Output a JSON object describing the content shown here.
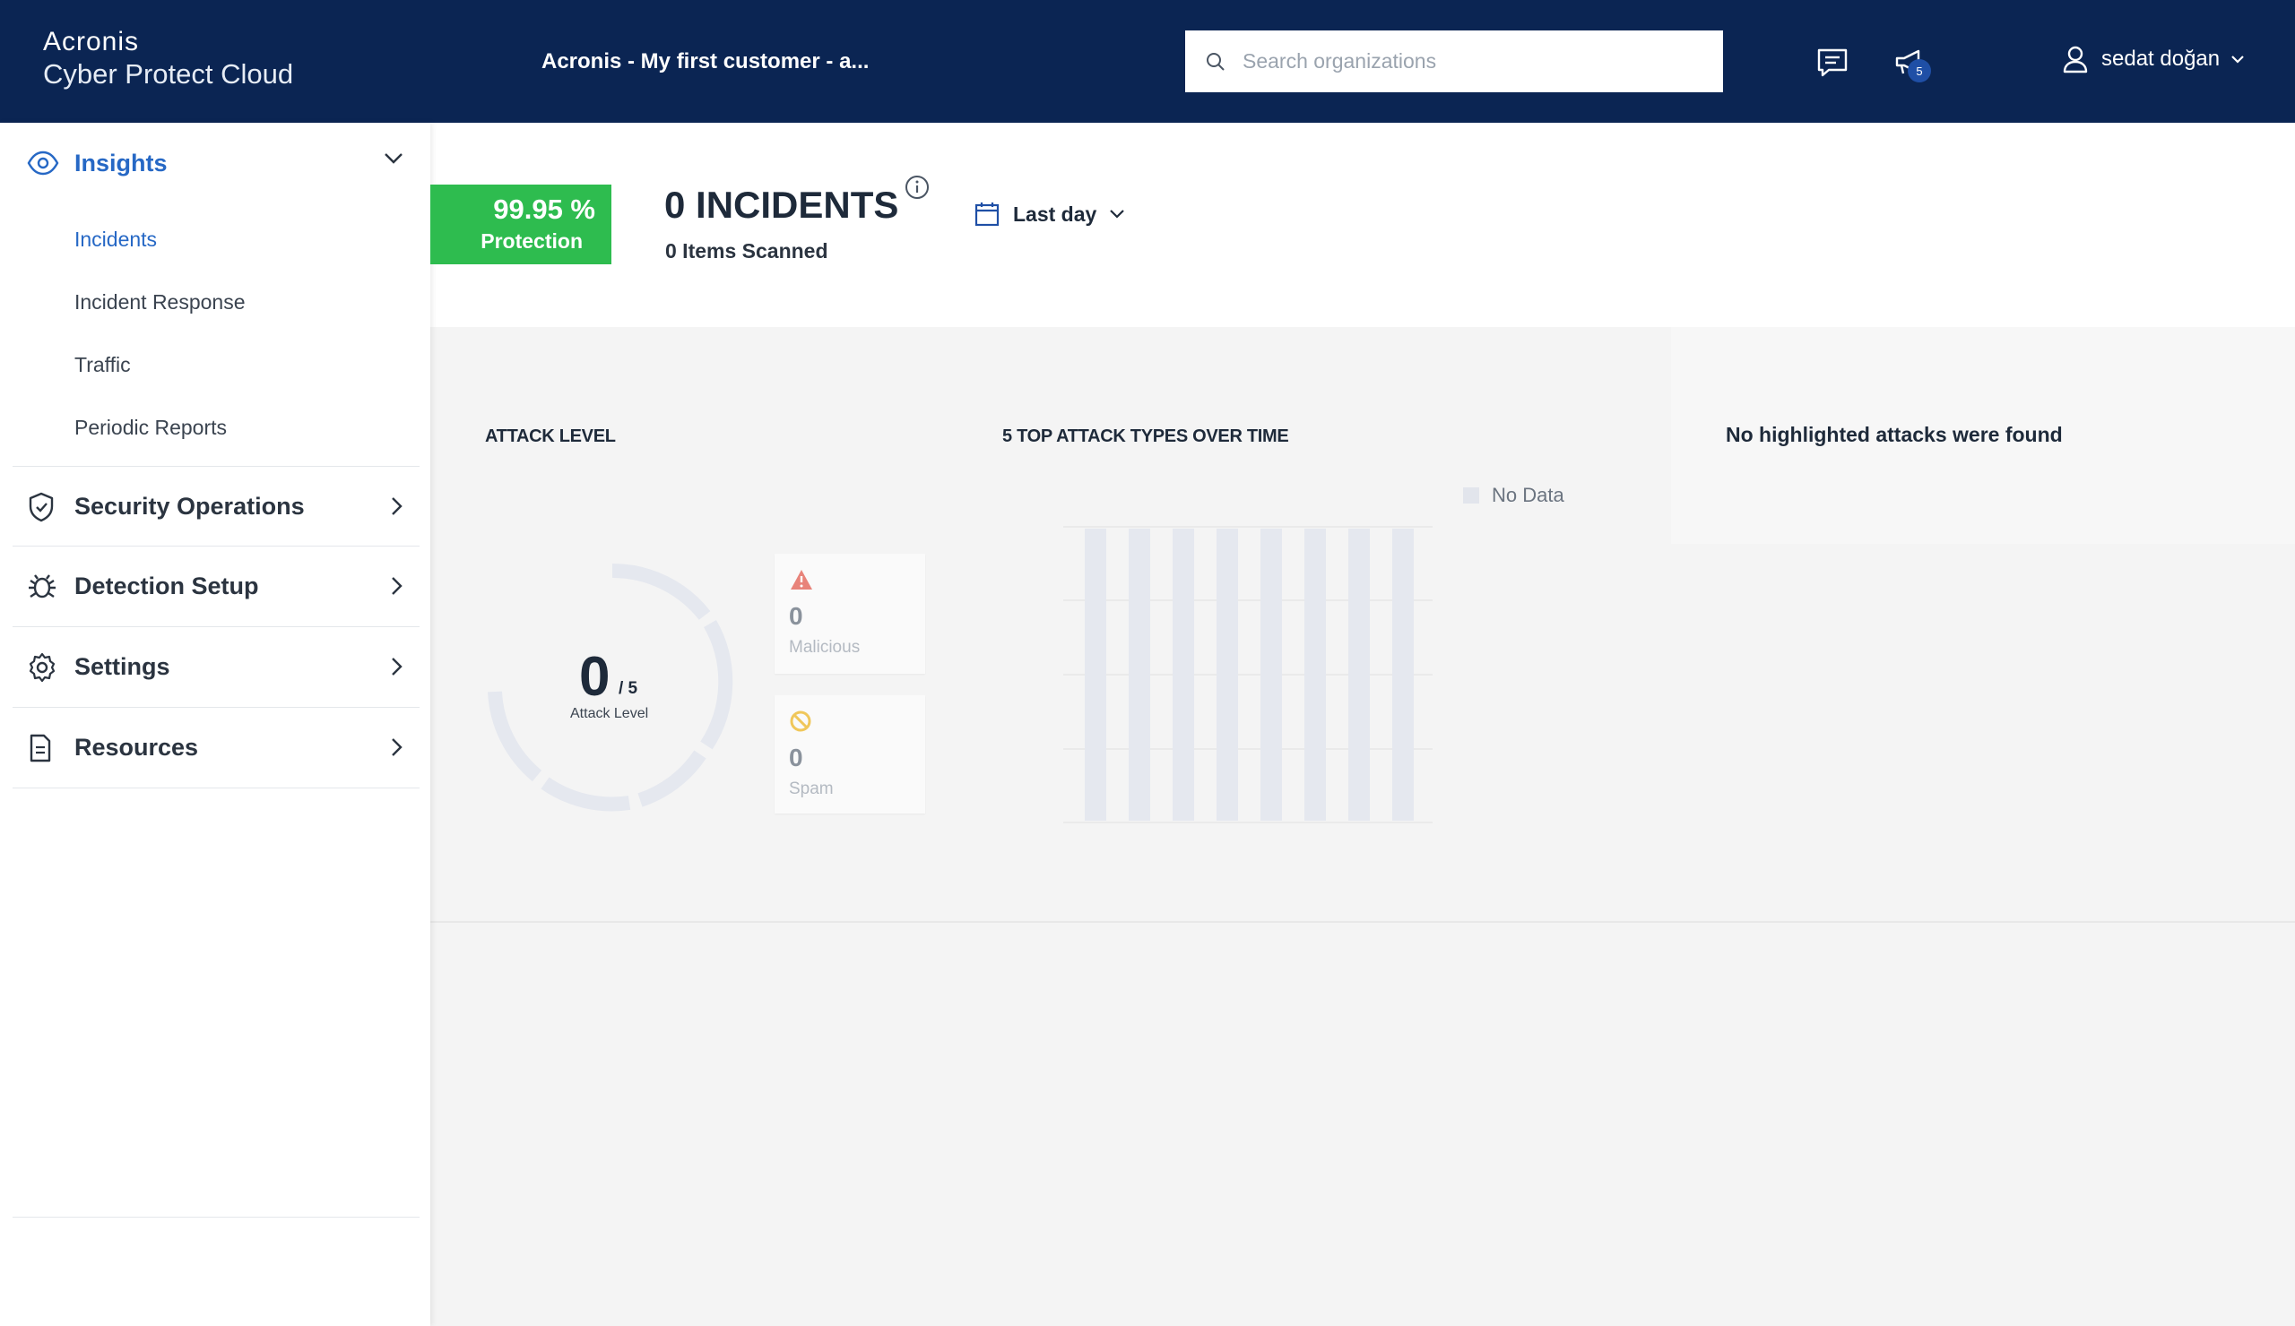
{
  "brand": {
    "line1": "Acronis",
    "line2": "Cyber Protect Cloud"
  },
  "header": {
    "org_title": "Acronis - My first customer - a...",
    "search_placeholder": "Search organizations",
    "notification_count": "5",
    "user_name": "sedat doğan"
  },
  "sidebar": {
    "insights": {
      "label": "Insights"
    },
    "sub_items": [
      {
        "label": "Incidents",
        "active": true
      },
      {
        "label": "Incident Response"
      },
      {
        "label": "Traffic"
      },
      {
        "label": "Periodic Reports"
      }
    ],
    "groups": [
      {
        "label": "Security Operations",
        "icon": "shield-icon"
      },
      {
        "label": "Detection Setup",
        "icon": "bug-icon"
      },
      {
        "label": "Settings",
        "icon": "gear-icon"
      },
      {
        "label": "Resources",
        "icon": "document-icon"
      }
    ]
  },
  "summary": {
    "protection_value": "99.95 %",
    "protection_label": "Protection",
    "incidents_title": "0 INCIDENTS",
    "items_scanned": "0 Items Scanned",
    "period_label": "Last day"
  },
  "attack_level": {
    "title": "ATTACK LEVEL",
    "value": "0",
    "max": "/ 5",
    "label": "Attack Level",
    "malicious_count": "0",
    "malicious_label": "Malicious",
    "spam_count": "0",
    "spam_label": "Spam"
  },
  "top_attacks": {
    "title": "5 TOP ATTACK TYPES OVER TIME",
    "legend_label": "No Data"
  },
  "highlighted": {
    "message": "No highlighted attacks were found"
  },
  "colors": {
    "topbar": "#0b2553",
    "accent": "#2668c5",
    "protection": "#2ebc4f",
    "malicious": "#e8837a",
    "spam": "#f0c75a"
  }
}
